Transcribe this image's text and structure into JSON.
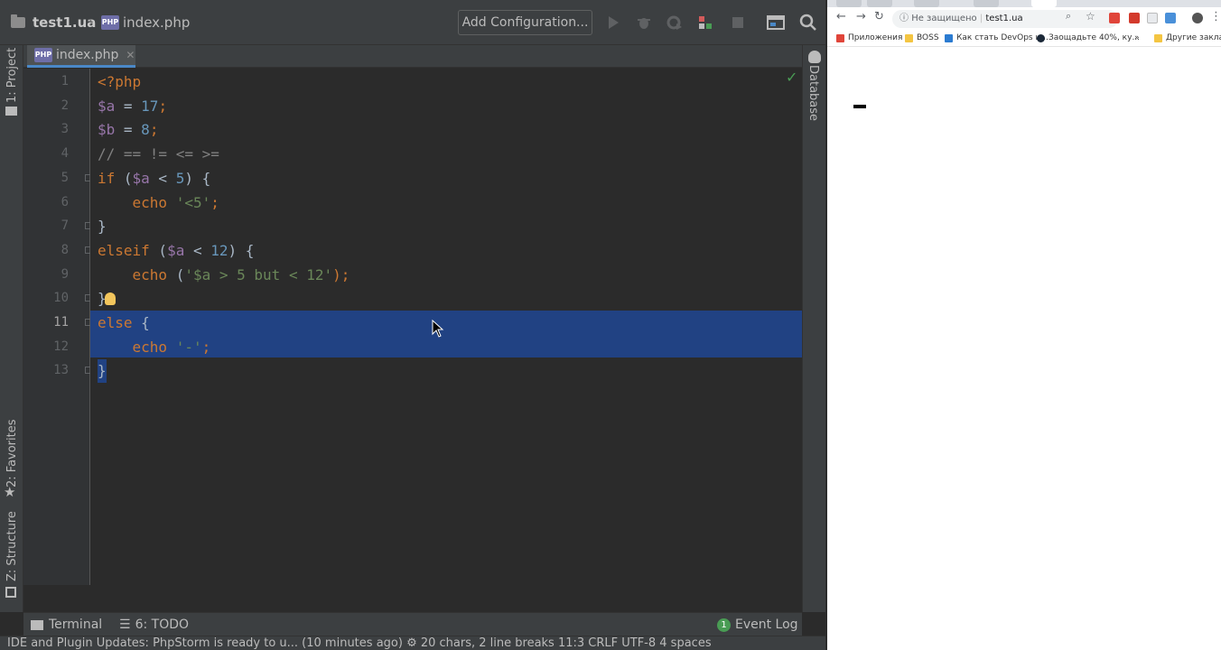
{
  "ide": {
    "project_name": "test1.ua",
    "breadcrumb_file": "index.php",
    "add_config_label": "Add Configuration...",
    "active_tab": "index.php",
    "left_tools": [
      "1: Project",
      "2: Favorites",
      "Z: Structure"
    ],
    "right_tools": [
      "Database"
    ],
    "code_lines": [
      {
        "n": "1",
        "tokens": [
          {
            "t": "<?php",
            "c": "kw"
          }
        ]
      },
      {
        "n": "2",
        "tokens": [
          {
            "t": "$a",
            "c": "var"
          },
          {
            "t": " = ",
            "c": ""
          },
          {
            "t": "17",
            "c": "num"
          },
          {
            "t": ";",
            "c": "kw"
          }
        ]
      },
      {
        "n": "3",
        "tokens": [
          {
            "t": "$b",
            "c": "var"
          },
          {
            "t": " = ",
            "c": ""
          },
          {
            "t": "8",
            "c": "num"
          },
          {
            "t": ";",
            "c": "kw"
          }
        ]
      },
      {
        "n": "4",
        "tokens": [
          {
            "t": "// == != <= >=",
            "c": "cmt"
          }
        ]
      },
      {
        "n": "5",
        "tokens": [
          {
            "t": "if",
            "c": "kw"
          },
          {
            "t": " (",
            "c": ""
          },
          {
            "t": "$a",
            "c": "var"
          },
          {
            "t": " < ",
            "c": ""
          },
          {
            "t": "5",
            "c": "num"
          },
          {
            "t": ") {",
            "c": ""
          }
        ]
      },
      {
        "n": "6",
        "tokens": [
          {
            "t": "    echo ",
            "c": "kw"
          },
          {
            "t": "'<5'",
            "c": "str"
          },
          {
            "t": ";",
            "c": "kw"
          }
        ]
      },
      {
        "n": "7",
        "tokens": [
          {
            "t": "}",
            "c": ""
          }
        ]
      },
      {
        "n": "8",
        "tokens": [
          {
            "t": "elseif",
            "c": "kw"
          },
          {
            "t": " (",
            "c": ""
          },
          {
            "t": "$a",
            "c": "var"
          },
          {
            "t": " < ",
            "c": ""
          },
          {
            "t": "12",
            "c": "num"
          },
          {
            "t": ") {",
            "c": ""
          }
        ]
      },
      {
        "n": "9",
        "tokens": [
          {
            "t": "    echo ",
            "c": "kw"
          },
          {
            "t": "(",
            "c": ""
          },
          {
            "t": "'$a > 5 but < 12'",
            "c": "str"
          },
          {
            "t": ");",
            "c": "kw"
          }
        ]
      },
      {
        "n": "10",
        "tokens": [
          {
            "t": "}",
            "c": ""
          }
        ]
      },
      {
        "n": "11",
        "tokens": [
          {
            "t": "else",
            "c": "kw"
          },
          {
            "t": " {",
            "c": ""
          }
        ]
      },
      {
        "n": "12",
        "tokens": [
          {
            "t": "    echo ",
            "c": "kw"
          },
          {
            "t": "'-'",
            "c": "str"
          },
          {
            "t": ";",
            "c": "kw"
          }
        ]
      },
      {
        "n": "13",
        "tokens": [
          {
            "t": "}",
            "c": ""
          }
        ]
      }
    ],
    "current_line": "11",
    "bottom_tools": {
      "terminal": "Terminal",
      "todo": "6: TODO",
      "event_log": "Event Log",
      "event_count": "1"
    },
    "status_text": "IDE and Plugin Updates: PhpStorm is ready to u... (10 minutes ago)  ⚙  20 chars, 2 line breaks    11:3   CRLF   UTF-8   4 spaces"
  },
  "browser": {
    "security_label": "Не защищено",
    "url": "test1.ua",
    "bookmarks": [
      "Приложения",
      "BOSS",
      "Как стать DevOps и...",
      "Заощадьте 40%, ку...",
      "»",
      "Другие закладки"
    ],
    "page_output": "-"
  },
  "colors": {
    "ide_bg": "#2b2b2b",
    "selection": "#214283",
    "keyword": "#cc7832",
    "variable": "#9876aa",
    "number": "#6897bb",
    "string": "#6a8759"
  }
}
